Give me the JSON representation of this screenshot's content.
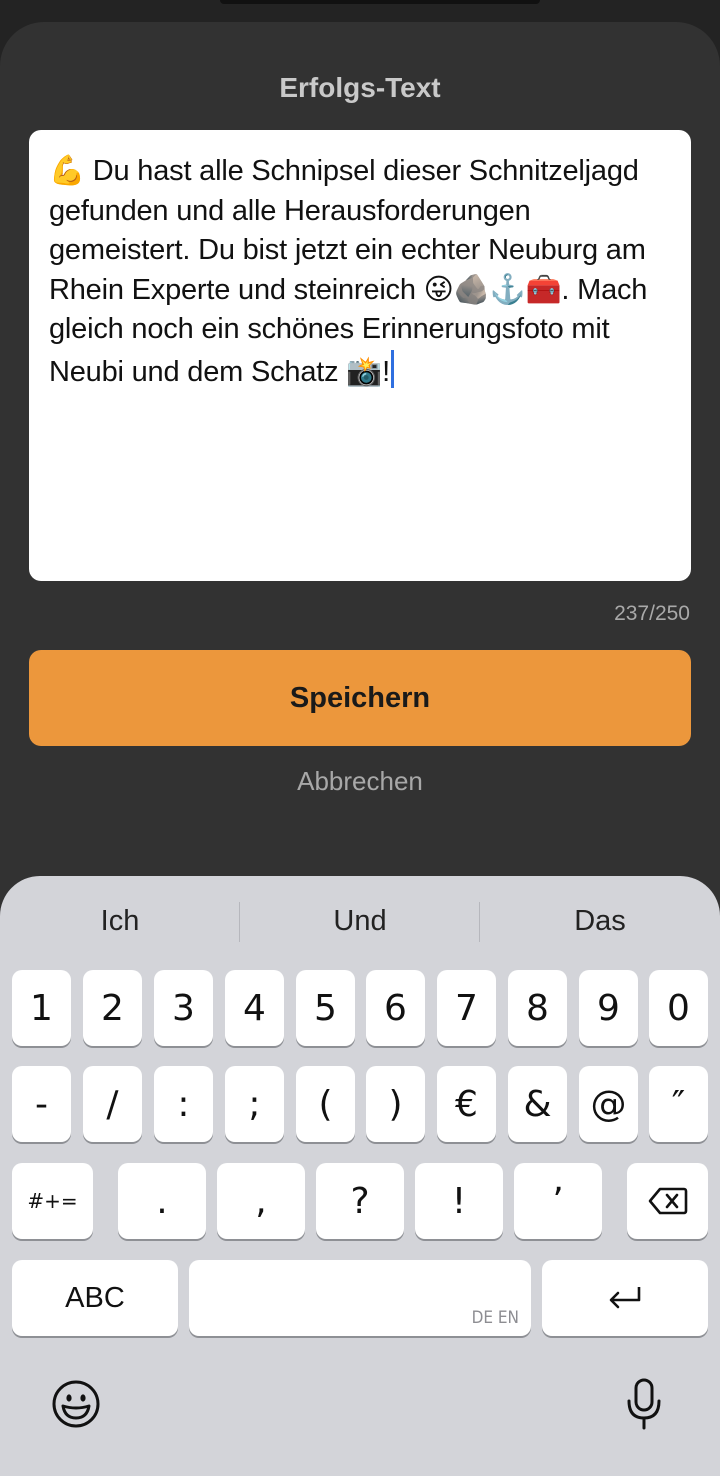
{
  "sheet": {
    "title": "Erfolgs-Text",
    "text_value": "💪 Du hast alle Schnipsel dieser Schnitzeljagd gefunden und alle Herausforderungen gemeistert. Du bist jetzt ein echter Neuburg am Rhein Experte und steinreich 😜🪨⚓️🧰. Mach gleich noch ein schönes Erinnerungsfoto mit Neubi und dem Schatz 📸!",
    "char_counter": "237/250",
    "save_label": "Speichern",
    "cancel_label": "Abbrechen"
  },
  "keyboard": {
    "suggestions": [
      "Ich",
      "Und",
      "Das"
    ],
    "row1": [
      "1",
      "2",
      "3",
      "4",
      "5",
      "6",
      "7",
      "8",
      "9",
      "0"
    ],
    "row2": [
      "-",
      "/",
      ":",
      ";",
      "(",
      ")",
      "€",
      "&",
      "@",
      "″"
    ],
    "row3": [
      "#+=",
      ".",
      ",",
      "?",
      "!",
      "’"
    ],
    "abc_label": "ABC",
    "space_hint": "DE EN",
    "icons": {
      "delete": "delete-icon",
      "return": "return-icon",
      "emoji": "emoji-icon",
      "mic": "microphone-icon"
    }
  },
  "colors": {
    "accent": "#ec973c",
    "sheet_bg": "#323232",
    "keyboard_bg": "#d3d4d9",
    "caret": "#2f6fe0"
  }
}
